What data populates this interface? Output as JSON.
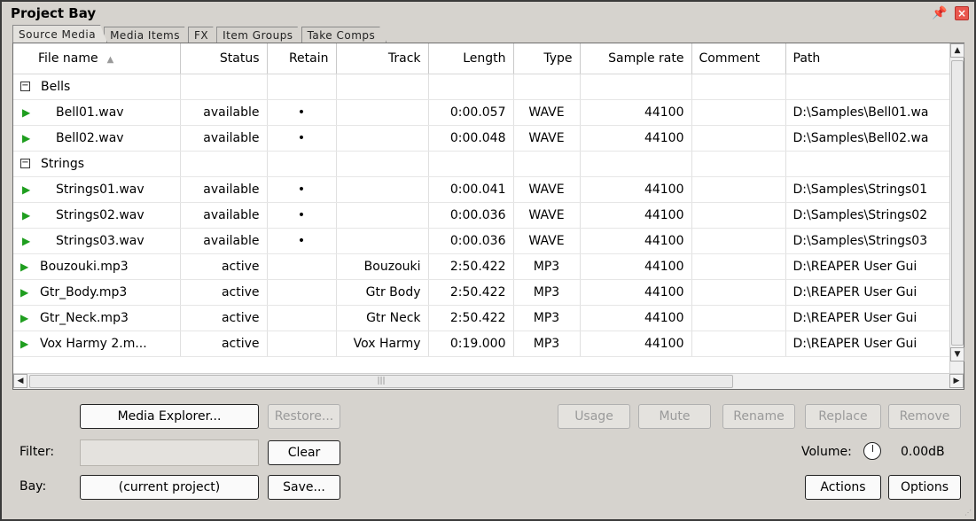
{
  "window": {
    "title": "Project Bay"
  },
  "tabs": [
    "Source Media",
    "Media Items",
    "FX",
    "Item Groups",
    "Take Comps"
  ],
  "columns": [
    "File name",
    "Status",
    "Retain",
    "Track",
    "Length",
    "Type",
    "Sample rate",
    "Comment",
    "Path"
  ],
  "rows": [
    {
      "kind": "group",
      "name": "Bells"
    },
    {
      "kind": "child",
      "name": "Bell01.wav",
      "status": "available",
      "retain": "•",
      "track": "",
      "length": "0:00.057",
      "type": "WAVE",
      "rate": "44100",
      "comment": "",
      "path": "D:\\Samples\\Bell01.wa"
    },
    {
      "kind": "child",
      "name": "Bell02.wav",
      "status": "available",
      "retain": "•",
      "track": "",
      "length": "0:00.048",
      "type": "WAVE",
      "rate": "44100",
      "comment": "",
      "path": "D:\\Samples\\Bell02.wa"
    },
    {
      "kind": "group",
      "name": "Strings"
    },
    {
      "kind": "child",
      "name": "Strings01.wav",
      "status": "available",
      "retain": "•",
      "track": "",
      "length": "0:00.041",
      "type": "WAVE",
      "rate": "44100",
      "comment": "",
      "path": "D:\\Samples\\Strings01"
    },
    {
      "kind": "child",
      "name": "Strings02.wav",
      "status": "available",
      "retain": "•",
      "track": "",
      "length": "0:00.036",
      "type": "WAVE",
      "rate": "44100",
      "comment": "",
      "path": "D:\\Samples\\Strings02"
    },
    {
      "kind": "child",
      "name": "Strings03.wav",
      "status": "available",
      "retain": "•",
      "track": "",
      "length": "0:00.036",
      "type": "WAVE",
      "rate": "44100",
      "comment": "",
      "path": "D:\\Samples\\Strings03"
    },
    {
      "kind": "item",
      "name": "Bouzouki.mp3",
      "status": "active",
      "retain": "",
      "track": "Bouzouki",
      "length": "2:50.422",
      "type": "MP3",
      "rate": "44100",
      "comment": "",
      "path": "D:\\REAPER User Gui"
    },
    {
      "kind": "item",
      "name": "Gtr_Body.mp3",
      "status": "active",
      "retain": "",
      "track": "Gtr Body",
      "length": "2:50.422",
      "type": "MP3",
      "rate": "44100",
      "comment": "",
      "path": "D:\\REAPER User Gui"
    },
    {
      "kind": "item",
      "name": "Gtr_Neck.mp3",
      "status": "active",
      "retain": "",
      "track": "Gtr Neck",
      "length": "2:50.422",
      "type": "MP3",
      "rate": "44100",
      "comment": "",
      "path": "D:\\REAPER User Gui"
    },
    {
      "kind": "item",
      "name": "Vox Harmy 2.m...",
      "status": "active",
      "retain": "",
      "track": "Vox Harmy",
      "length": "0:19.000",
      "type": "MP3",
      "rate": "44100",
      "comment": "",
      "path": "D:\\REAPER User Gui"
    }
  ],
  "buttons": {
    "media_explorer": "Media Explorer...",
    "restore": "Restore...",
    "clear": "Clear",
    "current_project": "(current project)",
    "save": "Save...",
    "usage": "Usage",
    "mute": "Mute",
    "rename": "Rename",
    "replace": "Replace",
    "remove": "Remove",
    "actions": "Actions",
    "options": "Options"
  },
  "labels": {
    "filter": "Filter:",
    "bay": "Bay:",
    "volume": "Volume:",
    "volume_value": "0.00dB"
  },
  "filter_value": ""
}
